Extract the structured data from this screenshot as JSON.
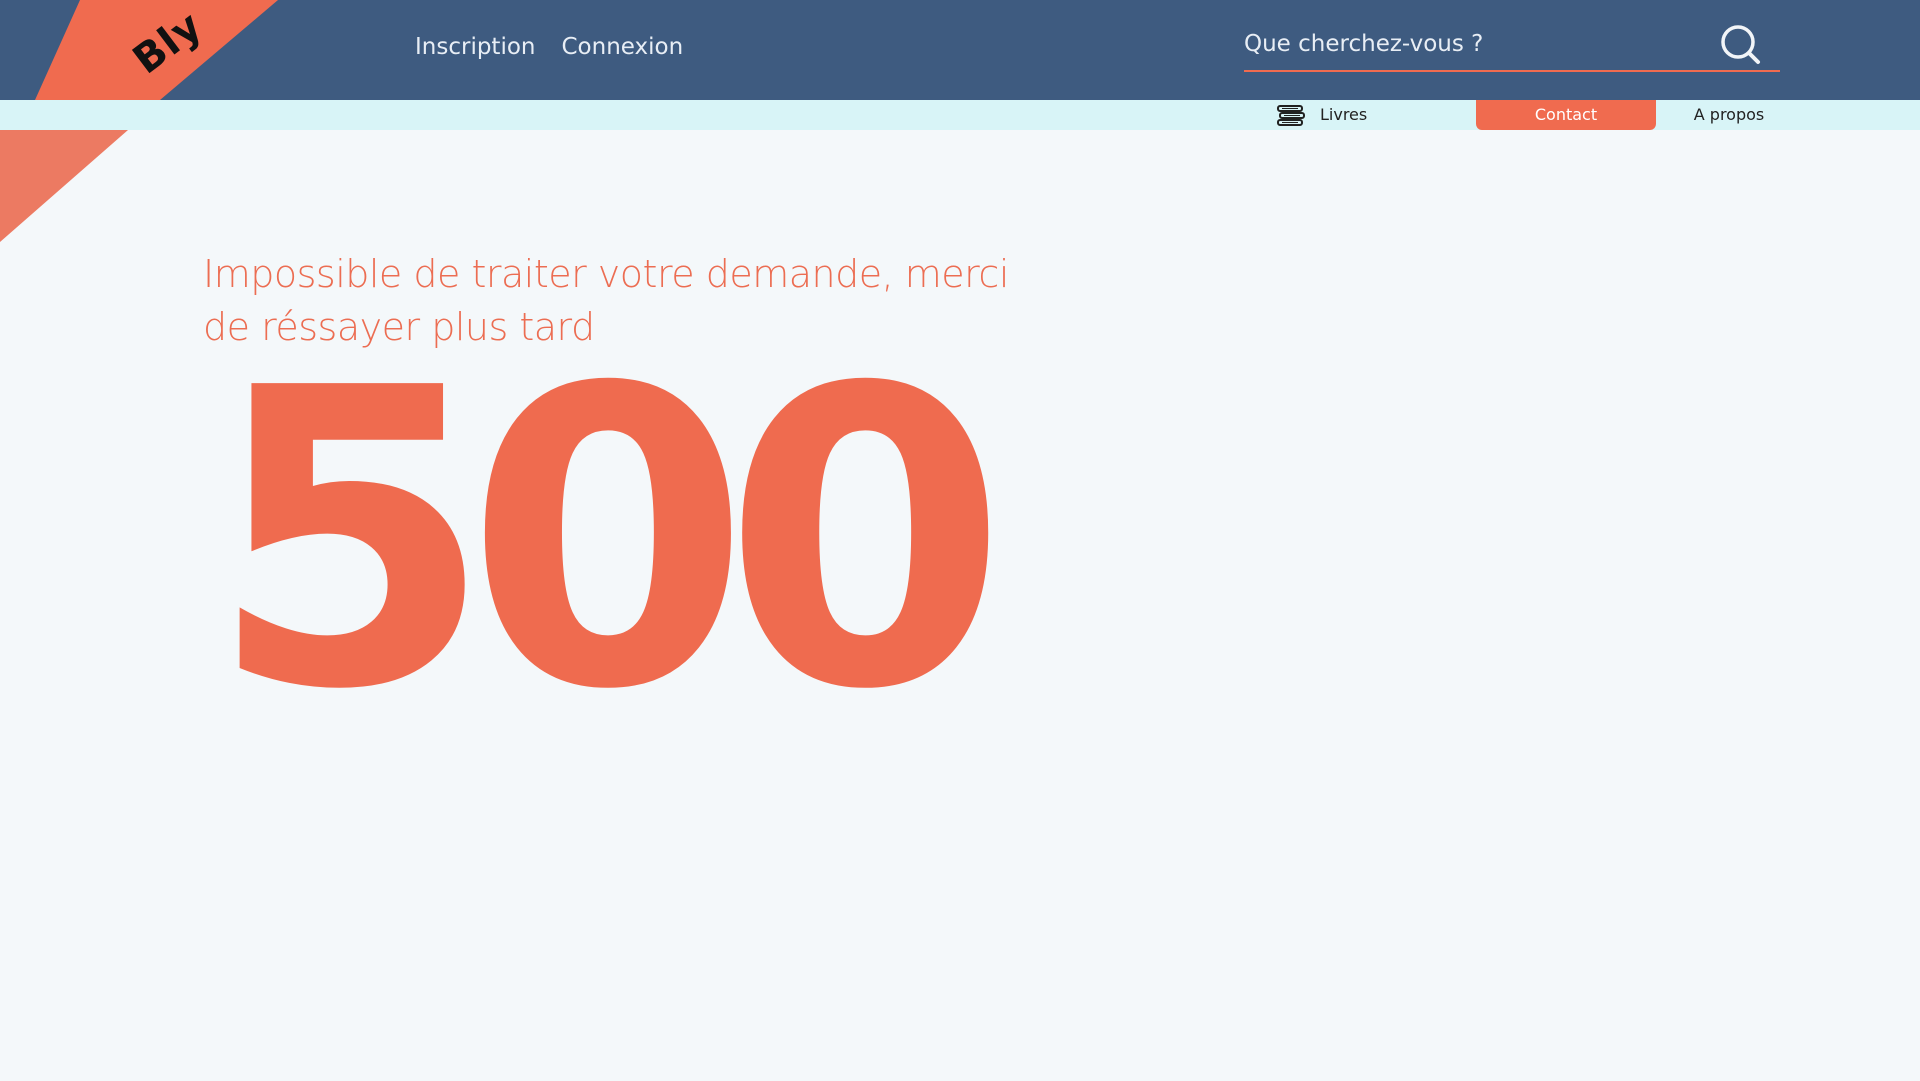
{
  "brand": {
    "logo_text": "Bly",
    "accent_color": "#f06b4f",
    "header_color": "#3e5b80",
    "subbar_color": "#d8f4f7"
  },
  "top_nav": {
    "signup_label": "Inscription",
    "login_label": "Connexion"
  },
  "search": {
    "placeholder": "Que cherchez-vous ?",
    "value": "",
    "icon": "search-icon"
  },
  "sub_nav": {
    "books_label": "Livres",
    "books_icon": "books-icon",
    "contact_label": "Contact",
    "about_label": "A propos",
    "active": "Contact"
  },
  "error": {
    "message": "Impossible de traiter votre demande, merci de réssayer plus tard",
    "code": "500"
  }
}
